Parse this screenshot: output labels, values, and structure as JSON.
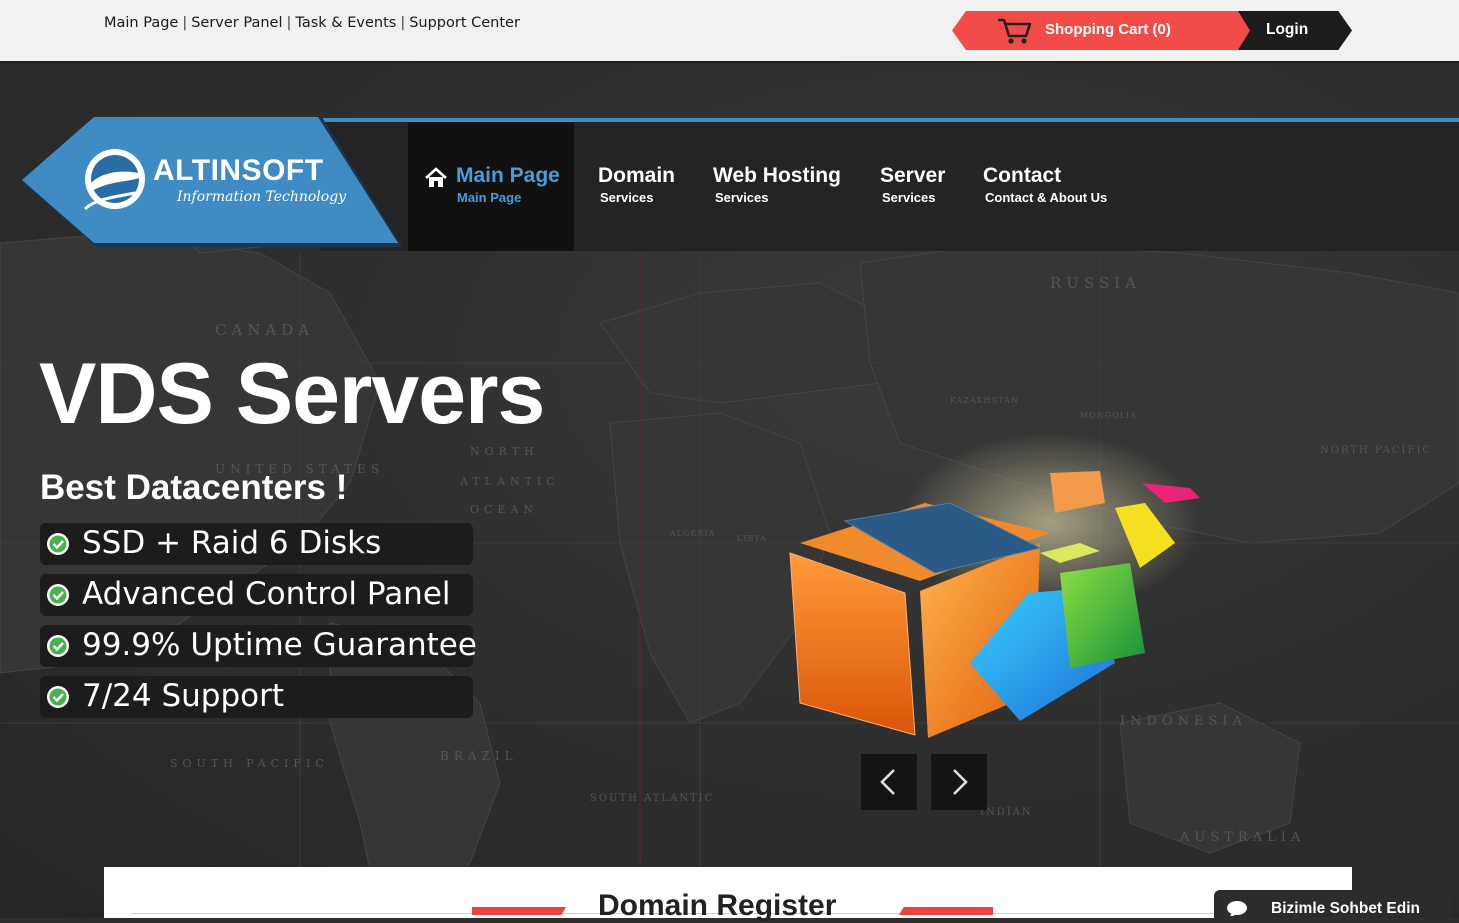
{
  "top_links": [
    {
      "label": "Main Page"
    },
    {
      "label": "Server Panel"
    },
    {
      "label": "Task & Events"
    },
    {
      "label": "Support Center"
    }
  ],
  "top_links_separator": "|",
  "cart": {
    "label": "Shopping Cart (0)",
    "icon": "shopping-cart-icon",
    "color": "#f14c48"
  },
  "login": {
    "label": "Login"
  },
  "logo": {
    "name": "ALTINSOFT",
    "tagline": "Information Technology",
    "color": "#3f8bc4"
  },
  "nav": [
    {
      "title": "Main Page",
      "sub": "Main Page",
      "icon": "home-icon",
      "active": true
    },
    {
      "title": "Domain",
      "sub": "Services"
    },
    {
      "title": "Web Hosting",
      "sub": "Services"
    },
    {
      "title": "Server",
      "sub": "Services"
    },
    {
      "title": "Contact",
      "sub": "Contact & About Us"
    }
  ],
  "hero": {
    "title": "VDS Servers",
    "subtitle": "Best Datacenters !",
    "features": [
      "SSD + Raid 6 Disks",
      "Advanced Control Panel",
      "99.9% Uptime Guarantee",
      "7/24 Support"
    ],
    "feature_icon": "check-circle-icon",
    "map_labels": [
      "RUSSIA",
      "CANADA",
      "UNITED STATES",
      "NORTH",
      "ATLANTIC",
      "OCEAN",
      "BRAZIL",
      "SOUTH PACIFIC",
      "INDONESIA",
      "AUSTRALIA",
      "KAZAKHSTAN",
      "MONGOLIA",
      "ALGERIA",
      "LIBYA",
      "NORTH PACIFIC",
      "INDIAN",
      "SOUTH ATLANTIC"
    ]
  },
  "slider": {
    "prev_icon": "chevron-left-icon",
    "next_icon": "chevron-right-icon"
  },
  "domain_register": {
    "title": "Domain Register"
  },
  "chat": {
    "label": "Bizimle Sohbet Edin",
    "icon": "chat-bubble-icon"
  },
  "colors": {
    "accent_blue": "#3f8bc4",
    "accent_red": "#e8453f",
    "nav_bg": "#242424"
  }
}
